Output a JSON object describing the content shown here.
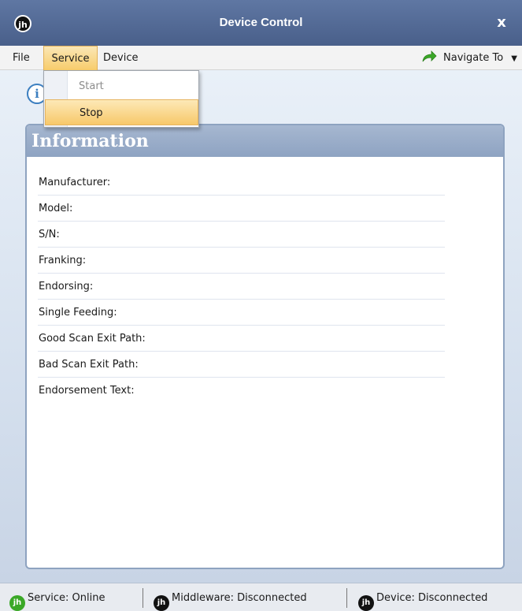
{
  "window": {
    "title": "Device Control",
    "close_label": "x",
    "logo_text": "jh"
  },
  "menu": {
    "file": "File",
    "service": "Service",
    "device": "Device",
    "navigate": "Navigate To",
    "navigate_caret": "▼"
  },
  "service_menu": {
    "start": "Start",
    "stop": "Stop"
  },
  "info_badge": "i",
  "panel": {
    "title": "Information",
    "fields": [
      "Manufacturer:",
      "Model:",
      "S/N:",
      "Franking:",
      "Endorsing:",
      "Single Feeding:",
      "Good Scan Exit Path:",
      "Bad Scan Exit Path:",
      "Endorsement Text:"
    ]
  },
  "status": {
    "service": "Service: Online",
    "middleware": "Middleware: Disconnected",
    "device": "Device: Disconnected",
    "logo_text": "jh"
  },
  "colors": {
    "title_bar": "#4f6690",
    "accent_highlight": "#f7c86a",
    "online": "#3aa827"
  },
  "icons": {
    "navigate": "green-curved-arrow-icon",
    "info": "info-icon"
  }
}
